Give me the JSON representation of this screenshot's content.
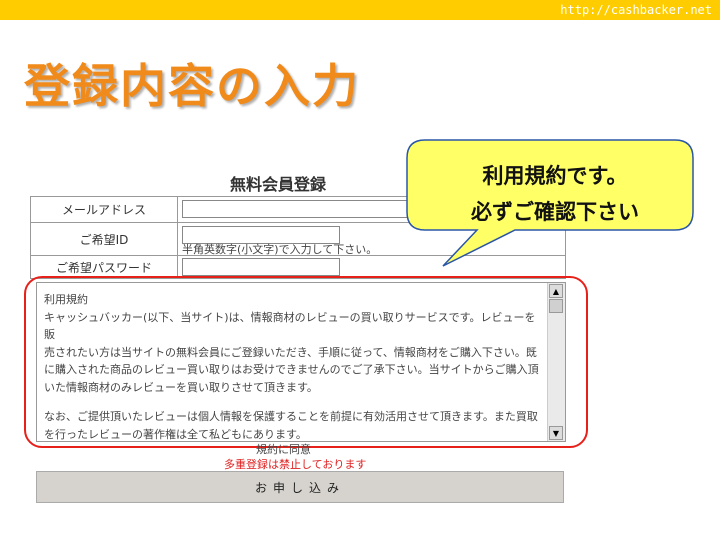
{
  "slide": {
    "url": "http://cashbacker.net",
    "title": "登録内容の入力"
  },
  "form": {
    "title": "無料会員登録",
    "fields": [
      {
        "label": "メールアドレス",
        "value": ""
      },
      {
        "label": "ご希望ID",
        "value": "",
        "hint": "半角英数字(小文字)で入力して下さい。"
      },
      {
        "label": "ご希望パスワード",
        "value": ""
      }
    ],
    "terms": {
      "heading": "利用規約",
      "paragraph1": [
        "キャッシュバッカー(以下、当サイト)は、情報商材のレビューの買い取りサービスです。レビューを販",
        "売されたい方は当サイトの無料会員にご登録いただき、手順に従って、情報商材をご購入下さい。既",
        "に購入された商品のレビュー買い取りはお受けできませんのでご了承下さい。当サイトからご購入頂",
        "いた情報商材のみレビューを買い取りさせて頂きます。"
      ],
      "paragraph2": [
        "なお、ご提供頂いたレビューは個人情報を保護することを前提に有効活用させて頂きます。また買取",
        "を行ったレビューの著作権は全て私どもにあります。"
      ]
    },
    "agree_label": "規約に同意",
    "warning": "多重登録は禁止しております",
    "submit_label": "お申し込み"
  },
  "callout": {
    "line1": "利用規約です。",
    "line2": "必ずご確認下さい"
  },
  "colors": {
    "topbar": "#ffcc00",
    "title": "#f08a1a",
    "callout_fill": "#ffff66",
    "highlight": "#e8201a",
    "warning": "#e02020"
  }
}
